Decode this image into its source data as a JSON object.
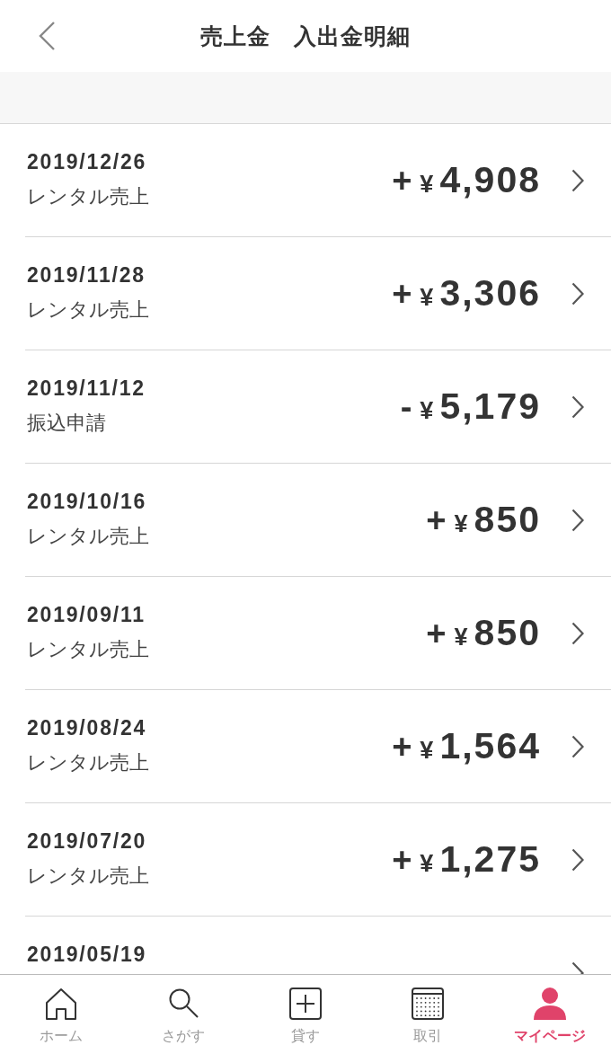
{
  "header": {
    "title": "売上金　入出金明細"
  },
  "transactions": [
    {
      "date": "2019/12/26",
      "type": "レンタル売上",
      "sign": "+",
      "currency": "¥",
      "amount": "4,908"
    },
    {
      "date": "2019/11/28",
      "type": "レンタル売上",
      "sign": "+",
      "currency": "¥",
      "amount": "3,306"
    },
    {
      "date": "2019/11/12",
      "type": "振込申請",
      "sign": "-",
      "currency": "¥",
      "amount": "5,179"
    },
    {
      "date": "2019/10/16",
      "type": "レンタル売上",
      "sign": "+",
      "currency": "¥",
      "amount": "850"
    },
    {
      "date": "2019/09/11",
      "type": "レンタル売上",
      "sign": "+",
      "currency": "¥",
      "amount": "850"
    },
    {
      "date": "2019/08/24",
      "type": "レンタル売上",
      "sign": "+",
      "currency": "¥",
      "amount": "1,564"
    },
    {
      "date": "2019/07/20",
      "type": "レンタル売上",
      "sign": "+",
      "currency": "¥",
      "amount": "1,275"
    },
    {
      "date": "2019/05/19"
    }
  ],
  "tab_bar": [
    {
      "kind": "home",
      "label": "ホーム",
      "selected": false
    },
    {
      "kind": "search",
      "label": "さがす",
      "selected": false
    },
    {
      "kind": "lend",
      "label": "貸す",
      "selected": false
    },
    {
      "kind": "deals",
      "label": "取引",
      "selected": false
    },
    {
      "kind": "mypage",
      "label": "マイページ",
      "selected": true
    }
  ]
}
